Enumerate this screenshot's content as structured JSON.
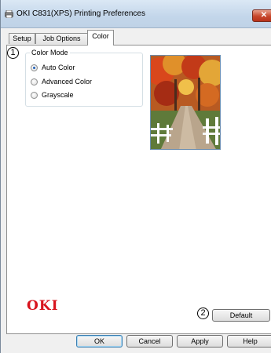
{
  "window": {
    "title": "OKI C831(XPS) Printing Preferences",
    "close_symbol": "✕"
  },
  "tabs": [
    {
      "label": "Setup",
      "active": false
    },
    {
      "label": "Job Options",
      "active": false
    },
    {
      "label": "Color",
      "active": true
    }
  ],
  "annotations": {
    "one": "1",
    "two": "2"
  },
  "color_mode": {
    "label": "Color Mode",
    "options": [
      {
        "label": "Auto Color",
        "checked": true
      },
      {
        "label": "Advanced Color",
        "checked": false
      },
      {
        "label": "Grayscale",
        "checked": false
      }
    ]
  },
  "logo": "OKI",
  "buttons": {
    "default": "Default",
    "ok": "OK",
    "cancel": "Cancel",
    "apply": "Apply",
    "help": "Help"
  },
  "colors": {
    "accent": "#1f5fb8",
    "logo": "#d8141e",
    "close_button": "#c7462b"
  }
}
